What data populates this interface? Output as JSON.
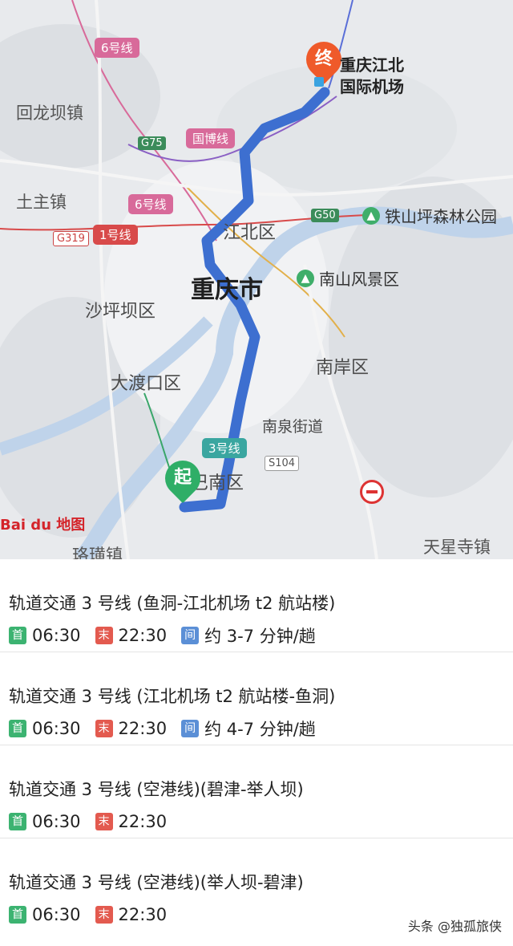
{
  "map": {
    "city": "重庆市",
    "districts": [
      "江北区",
      "沙坪坝区",
      "大渡口区",
      "南岸区",
      "巴南区"
    ],
    "towns": [
      "回龙坝镇",
      "土主镇",
      "南泉街道",
      "天星寺镇",
      "珞璜镇"
    ],
    "pois": [
      "铁山坪森林公园",
      "南山风景区"
    ],
    "metro_lines": [
      "6号线",
      "国博线",
      "6号线",
      "1号线",
      "3号线"
    ],
    "highways": [
      "G75",
      "G50",
      "G319",
      "S104"
    ],
    "start_label": "起",
    "end_label": "终",
    "airport_name_line1": "重庆江北",
    "airport_name_line2": "国际机场",
    "provider_logo": "Bai du 地图",
    "colors": {
      "route": "#3d6fd0",
      "start_pin": "#2fae67",
      "end_pin": "#ef5a2a",
      "line_tag_pink": "#d86a9a",
      "line_tag_red": "#d84a4a",
      "line_tag_teal": "#3aa6a0"
    }
  },
  "routes": [
    {
      "title": "轨道交通 3 号线 (鱼洞-江北机场 t2 航站楼)",
      "first_badge": "首",
      "first_time": "06:30",
      "last_badge": "末",
      "last_time": "22:30",
      "interval_badge": "间",
      "interval": "约 3-7 分钟/趟"
    },
    {
      "title": "轨道交通 3 号线 (江北机场 t2 航站楼-鱼洞)",
      "first_badge": "首",
      "first_time": "06:30",
      "last_badge": "末",
      "last_time": "22:30",
      "interval_badge": "间",
      "interval": "约 4-7 分钟/趟"
    },
    {
      "title": "轨道交通 3 号线 (空港线)(碧津-举人坝)",
      "first_badge": "首",
      "first_time": "06:30",
      "last_badge": "末",
      "last_time": "22:30"
    },
    {
      "title": "轨道交通 3 号线 (空港线)(举人坝-碧津)",
      "first_badge": "首",
      "first_time": "06:30",
      "last_badge": "末",
      "last_time": "22:30"
    }
  ],
  "watermark": "头条 @独孤旅侠"
}
